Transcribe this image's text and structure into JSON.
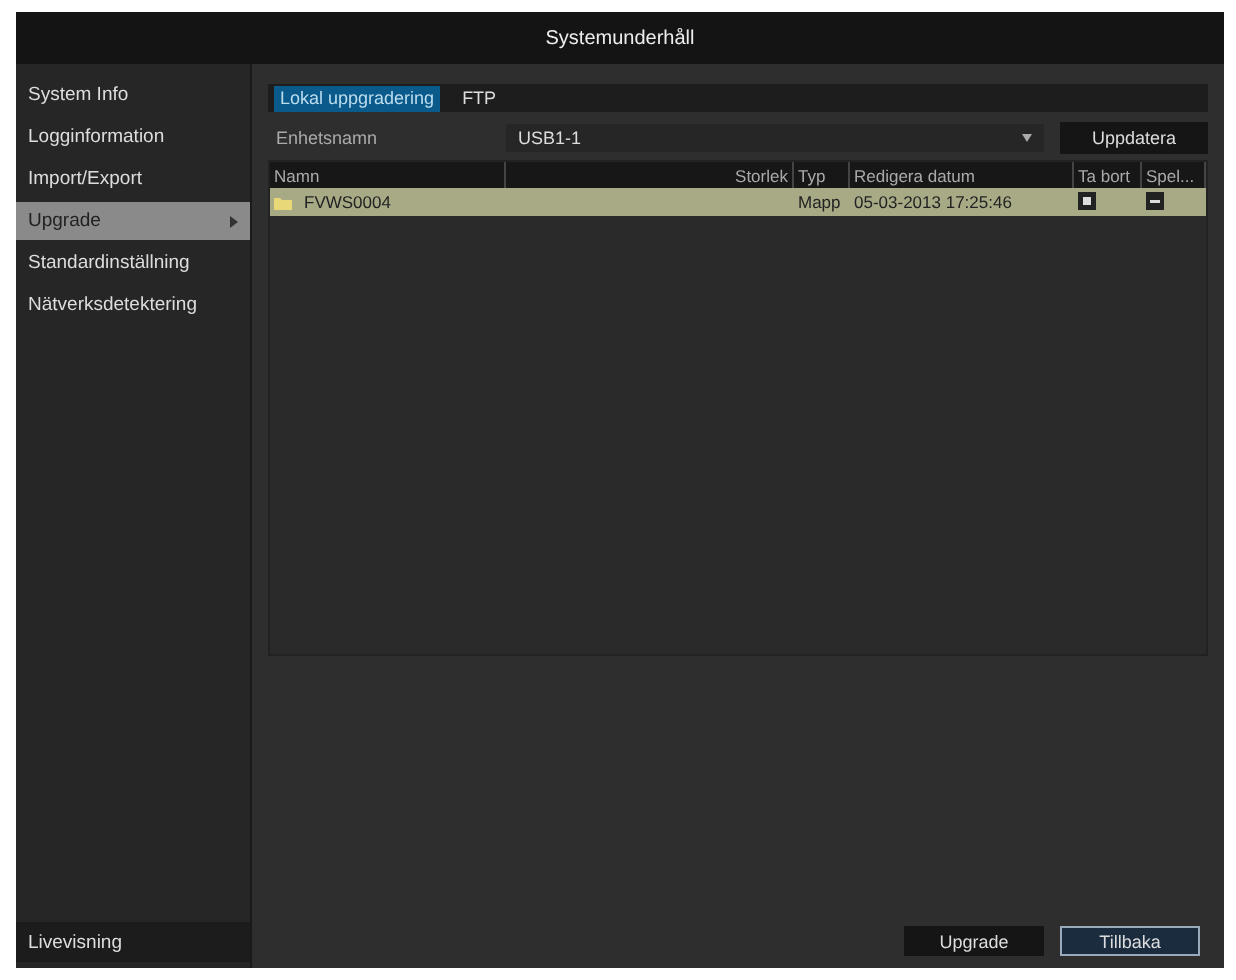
{
  "window": {
    "title": "Systemunderhåll"
  },
  "sidebar": {
    "items": [
      {
        "label": "System Info",
        "selected": false
      },
      {
        "label": "Logginformation",
        "selected": false
      },
      {
        "label": "Import/Export",
        "selected": false
      },
      {
        "label": "Upgrade",
        "selected": true
      },
      {
        "label": "Standardinställning",
        "selected": false
      },
      {
        "label": "Nätverksdetektering",
        "selected": false
      }
    ],
    "footer": "Livevisning"
  },
  "tabs": [
    {
      "label": "Lokal uppgradering",
      "selected": true
    },
    {
      "label": "FTP",
      "selected": false
    }
  ],
  "device": {
    "label": "Enhetsnamn",
    "value": "USB1-1",
    "refresh": "Uppdatera"
  },
  "table": {
    "columns": [
      "Namn",
      "Storlek",
      "Typ",
      "Redigera datum",
      "Ta bort",
      "Spel..."
    ],
    "rows": [
      {
        "name": "FVWS0004",
        "size": "",
        "type": "Mapp",
        "date": "05-03-2013 17:25:46",
        "selected": true
      }
    ]
  },
  "buttons": [
    {
      "label": "Upgrade",
      "selected": false
    },
    {
      "label": "Tillbaka",
      "selected": true
    }
  ]
}
